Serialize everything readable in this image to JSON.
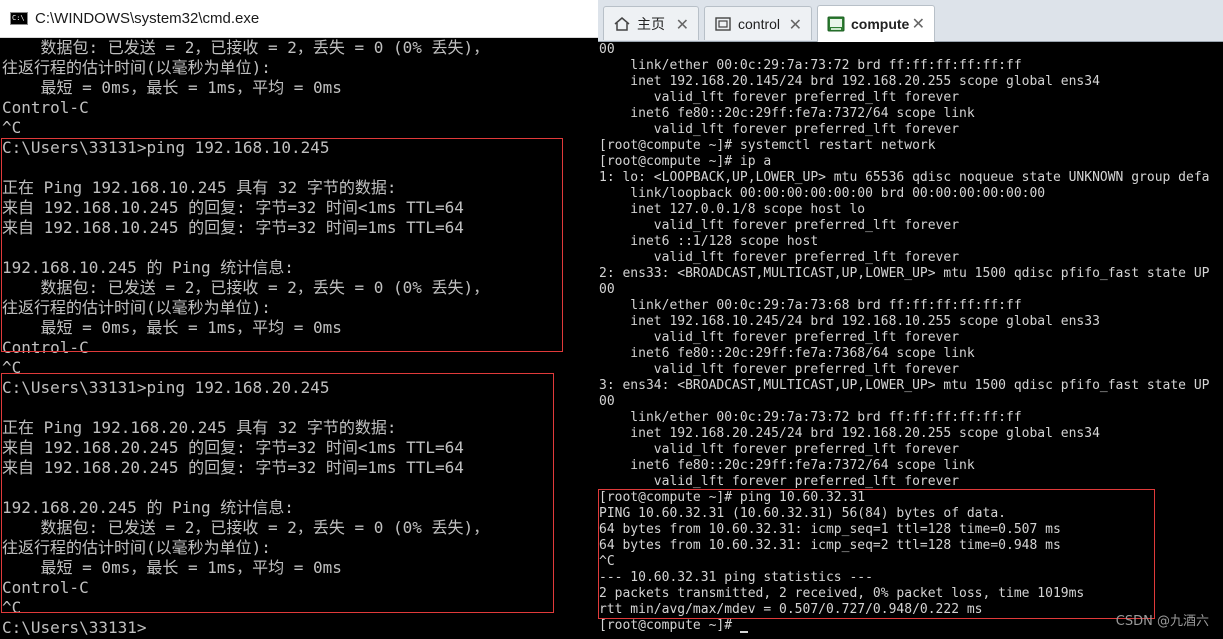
{
  "cmd": {
    "title": "C:\\WINDOWS\\system32\\cmd.exe",
    "icon_text": "C:\\",
    "lines": [
      "    数据包: 已发送 = 2，已接收 = 2，丢失 = 0 (0% 丢失)，",
      "往返行程的估计时间(以毫秒为单位):",
      "    最短 = 0ms，最长 = 1ms，平均 = 0ms",
      "Control-C",
      "^C",
      "C:\\Users\\33131>ping 192.168.10.245",
      "",
      "正在 Ping 192.168.10.245 具有 32 字节的数据:",
      "来自 192.168.10.245 的回复: 字节=32 时间<1ms TTL=64",
      "来自 192.168.10.245 的回复: 字节=32 时间=1ms TTL=64",
      "",
      "192.168.10.245 的 Ping 统计信息:",
      "    数据包: 已发送 = 2，已接收 = 2，丢失 = 0 (0% 丢失)，",
      "往返行程的估计时间(以毫秒为单位):",
      "    最短 = 0ms，最长 = 1ms，平均 = 0ms",
      "Control-C",
      "^C",
      "C:\\Users\\33131>ping 192.168.20.245",
      "",
      "正在 Ping 192.168.20.245 具有 32 字节的数据:",
      "来自 192.168.20.245 的回复: 字节=32 时间<1ms TTL=64",
      "来自 192.168.20.245 的回复: 字节=32 时间=1ms TTL=64",
      "",
      "192.168.20.245 的 Ping 统计信息:",
      "    数据包: 已发送 = 2，已接收 = 2，丢失 = 0 (0% 丢失)，",
      "往返行程的估计时间(以毫秒为单位):",
      "    最短 = 0ms，最长 = 1ms，平均 = 0ms",
      "Control-C",
      "^C",
      "C:\\Users\\33131>"
    ]
  },
  "terminal": {
    "tabs": [
      {
        "label": "主页",
        "icon": "home-icon",
        "close": "✕"
      },
      {
        "label": "control",
        "icon": "window-icon",
        "close": "✕"
      },
      {
        "label": "compute",
        "icon": "terminal-icon",
        "close": "✕",
        "active": true
      }
    ],
    "lines": [
      "00",
      "    link/ether 00:0c:29:7a:73:72 brd ff:ff:ff:ff:ff:ff",
      "    inet 192.168.20.145/24 brd 192.168.20.255 scope global ens34",
      "       valid_lft forever preferred_lft forever",
      "    inet6 fe80::20c:29ff:fe7a:7372/64 scope link",
      "       valid_lft forever preferred_lft forever",
      "[root@compute ~]# systemctl restart network",
      "[root@compute ~]# ip a",
      "1: lo: <LOOPBACK,UP,LOWER_UP> mtu 65536 qdisc noqueue state UNKNOWN group defa",
      "    link/loopback 00:00:00:00:00:00 brd 00:00:00:00:00:00",
      "    inet 127.0.0.1/8 scope host lo",
      "       valid_lft forever preferred_lft forever",
      "    inet6 ::1/128 scope host",
      "       valid_lft forever preferred_lft forever",
      "2: ens33: <BROADCAST,MULTICAST,UP,LOWER_UP> mtu 1500 qdisc pfifo_fast state UP",
      "00",
      "    link/ether 00:0c:29:7a:73:68 brd ff:ff:ff:ff:ff:ff",
      "    inet 192.168.10.245/24 brd 192.168.10.255 scope global ens33",
      "       valid_lft forever preferred_lft forever",
      "    inet6 fe80::20c:29ff:fe7a:7368/64 scope link",
      "       valid_lft forever preferred_lft forever",
      "3: ens34: <BROADCAST,MULTICAST,UP,LOWER_UP> mtu 1500 qdisc pfifo_fast state UP",
      "00",
      "    link/ether 00:0c:29:7a:73:72 brd ff:ff:ff:ff:ff:ff",
      "    inet 192.168.20.245/24 brd 192.168.20.255 scope global ens34",
      "       valid_lft forever preferred_lft forever",
      "    inet6 fe80::20c:29ff:fe7a:7372/64 scope link",
      "       valid_lft forever preferred_lft forever",
      "[root@compute ~]# ping 10.60.32.31",
      "PING 10.60.32.31 (10.60.32.31) 56(84) bytes of data.",
      "64 bytes from 10.60.32.31: icmp_seq=1 ttl=128 time=0.507 ms",
      "64 bytes from 10.60.32.31: icmp_seq=2 ttl=128 time=0.948 ms",
      "^C",
      "--- 10.60.32.31 ping statistics ---",
      "2 packets transmitted, 2 received, 0% packet loss, time 1019ms",
      "rtt min/avg/max/mdev = 0.507/0.727/0.948/0.222 ms",
      "[root@compute ~]# "
    ]
  },
  "colors": {
    "highlight_box": "#e03a3a",
    "console_bg": "#000000",
    "cmd_text": "#c0c0c0",
    "terminal_text": "#d4d4d4"
  },
  "watermark": "CSDN @九酒六"
}
